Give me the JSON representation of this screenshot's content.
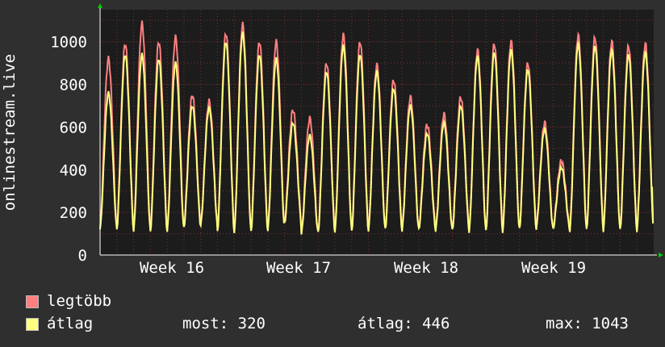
{
  "chart_data": {
    "type": "line",
    "ylabel": "onlinestream.live",
    "ylim": [
      0,
      1150
    ],
    "y_ticks": [
      0,
      200,
      400,
      600,
      800,
      1000
    ],
    "x_ticks": [
      "Week 16",
      "Week 17",
      "Week 18",
      "Week 19"
    ],
    "grid": true,
    "colors": {
      "background": "#2f2f2f",
      "plot": "#1c1c1c",
      "grid": "#7a3030",
      "axis": "#ffffff",
      "arrow": "#00cc00",
      "max_series": "#ff7f7f",
      "avg_series": "#ffff80"
    },
    "days": 33,
    "daily_peaks_max": [
      920,
      990,
      1085,
      1000,
      1020,
      750,
      720,
      1040,
      1080,
      1000,
      1000,
      680,
      640,
      900,
      1030,
      1000,
      890,
      820,
      740,
      610,
      660,
      740,
      960,
      990,
      1000,
      900,
      620,
      440,
      1030,
      1020,
      1000,
      980,
      990
    ],
    "daily_peaks_avg": [
      760,
      940,
      940,
      920,
      900,
      700,
      690,
      1000,
      1040,
      940,
      920,
      620,
      560,
      860,
      980,
      940,
      860,
      780,
      700,
      570,
      620,
      700,
      930,
      950,
      960,
      870,
      590,
      410,
      990,
      980,
      960,
      940,
      950
    ],
    "daily_mins_max": [
      130,
      130,
      120,
      120,
      120,
      140,
      150,
      120,
      115,
      120,
      125,
      160,
      105,
      115,
      120,
      120,
      125,
      130,
      125,
      130,
      125,
      125,
      120,
      120,
      120,
      130,
      135,
      130,
      125,
      125,
      125,
      125,
      125
    ],
    "daily_mins_avg": [
      120,
      120,
      110,
      110,
      110,
      130,
      140,
      110,
      105,
      110,
      115,
      150,
      100,
      105,
      110,
      110,
      115,
      120,
      115,
      120,
      115,
      115,
      110,
      110,
      110,
      120,
      125,
      120,
      115,
      115,
      115,
      115,
      115
    ]
  },
  "legend": {
    "series": [
      {
        "label": "legtöbb",
        "color": "#ff7f7f"
      },
      {
        "label": "átlag",
        "color": "#ffff80"
      }
    ],
    "stats": {
      "most": "most: 320",
      "atlag": "átlag: 446",
      "max": "max: 1043"
    }
  }
}
